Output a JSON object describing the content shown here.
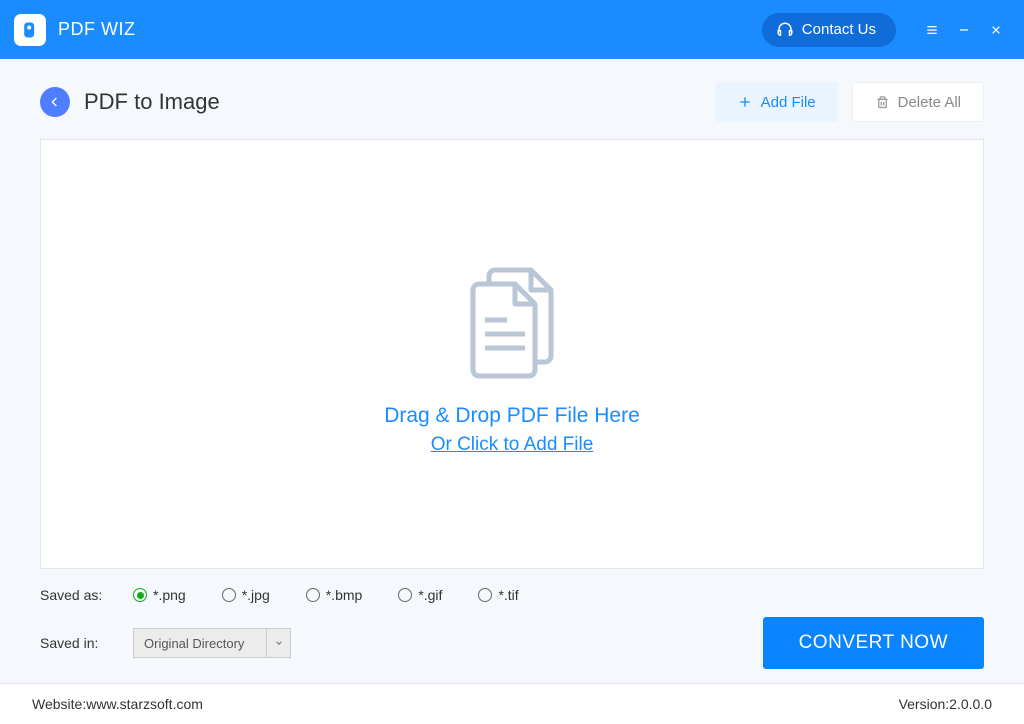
{
  "app": {
    "name": "PDF WIZ"
  },
  "titlebar": {
    "contact": "Contact Us"
  },
  "page": {
    "title": "PDF to Image",
    "add_file": "Add File",
    "delete_all": "Delete All"
  },
  "dropzone": {
    "line1": "Drag & Drop PDF File Here",
    "line2": "Or Click to Add File"
  },
  "options": {
    "saved_as_label": "Saved as:",
    "formats": [
      "*.png",
      "*.jpg",
      "*.bmp",
      "*.gif",
      "*.tif"
    ],
    "selected_format_index": 0,
    "saved_in_label": "Saved in:",
    "saved_in_value": "Original Directory",
    "convert": "CONVERT NOW"
  },
  "footer": {
    "website_label": "Website: ",
    "website": "www.starzsoft.com",
    "version_label": "Version: ",
    "version": "2.0.0.0"
  }
}
